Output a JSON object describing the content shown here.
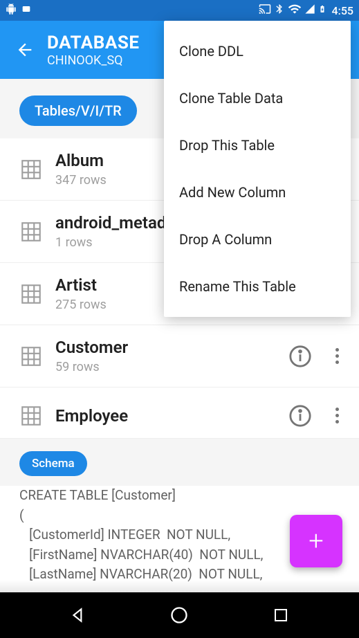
{
  "status": {
    "time": "4:55"
  },
  "appbar": {
    "title": "DATABASE",
    "subtitle": "CHINOOK_SQ"
  },
  "chip_tables": "Tables/V/I/TR",
  "chip_schema": "Schema",
  "tables": [
    {
      "name": "Album",
      "rows": "347 rows"
    },
    {
      "name": "android_metadata",
      "rows": "1 rows"
    },
    {
      "name": " Artist",
      "rows": "275 rows"
    },
    {
      "name": "Customer",
      "rows": "59 rows"
    },
    {
      "name": "Employee",
      "rows": ""
    }
  ],
  "schema": {
    "line0": "CREATE TABLE [Customer]",
    "line1": "(",
    "line2": "   [CustomerId] INTEGER  NOT NULL,",
    "line3": "   [FirstName] NVARCHAR(40)  NOT NULL,",
    "line4": "   [LastName] NVARCHAR(20)  NOT NULL,"
  },
  "menu": {
    "items": [
      "Clone DDL",
      "Clone Table Data",
      "Drop This Table",
      "Add New Column",
      "Drop A Column",
      "Rename This Table"
    ]
  },
  "fab_label": "+"
}
